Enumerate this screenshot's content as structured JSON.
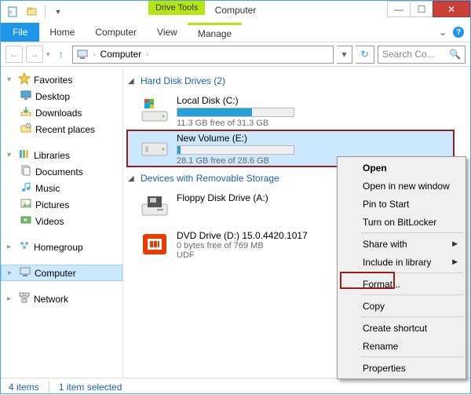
{
  "window": {
    "title": "Computer",
    "drive_tools": "Drive Tools"
  },
  "menubar": {
    "file": "File",
    "tabs": [
      "Home",
      "Computer",
      "View",
      "Manage"
    ]
  },
  "addressbar": {
    "location": "Computer",
    "chevron": "›",
    "search_placeholder": "Search Co..."
  },
  "sidebar": {
    "favorites": {
      "label": "Favorites",
      "items": [
        "Desktop",
        "Downloads",
        "Recent places"
      ]
    },
    "libraries": {
      "label": "Libraries",
      "items": [
        "Documents",
        "Music",
        "Pictures",
        "Videos"
      ]
    },
    "homegroup": {
      "label": "Homegroup"
    },
    "computer": {
      "label": "Computer"
    },
    "network": {
      "label": "Network"
    }
  },
  "content": {
    "hdd_section": {
      "title": "Hard Disk Drives (2)"
    },
    "dev_section": {
      "title": "Devices with Removable Storage"
    },
    "drives": [
      {
        "name": "Local Disk (C:)",
        "free": "11.3 GB free of 31.3 GB",
        "fill_pct": 64
      },
      {
        "name": "New Volume (E:)",
        "free": "28.1 GB free of 28.6 GB",
        "fill_pct": 3
      }
    ],
    "removable": [
      {
        "name": "Floppy Disk Drive (A:)",
        "free": "",
        "sub": ""
      },
      {
        "name": "DVD Drive (D:) 15.0.4420.1017",
        "free": "0 bytes free of 769 MB",
        "sub": "UDF"
      }
    ]
  },
  "context_menu": {
    "open": "Open",
    "open_new": "Open in new window",
    "pin": "Pin to Start",
    "bitlocker": "Turn on BitLocker",
    "share": "Share with",
    "include": "Include in library",
    "format": "Format...",
    "copy": "Copy",
    "shortcut": "Create shortcut",
    "rename": "Rename",
    "properties": "Properties"
  },
  "statusbar": {
    "count": "4 items",
    "selected": "1 item selected"
  }
}
